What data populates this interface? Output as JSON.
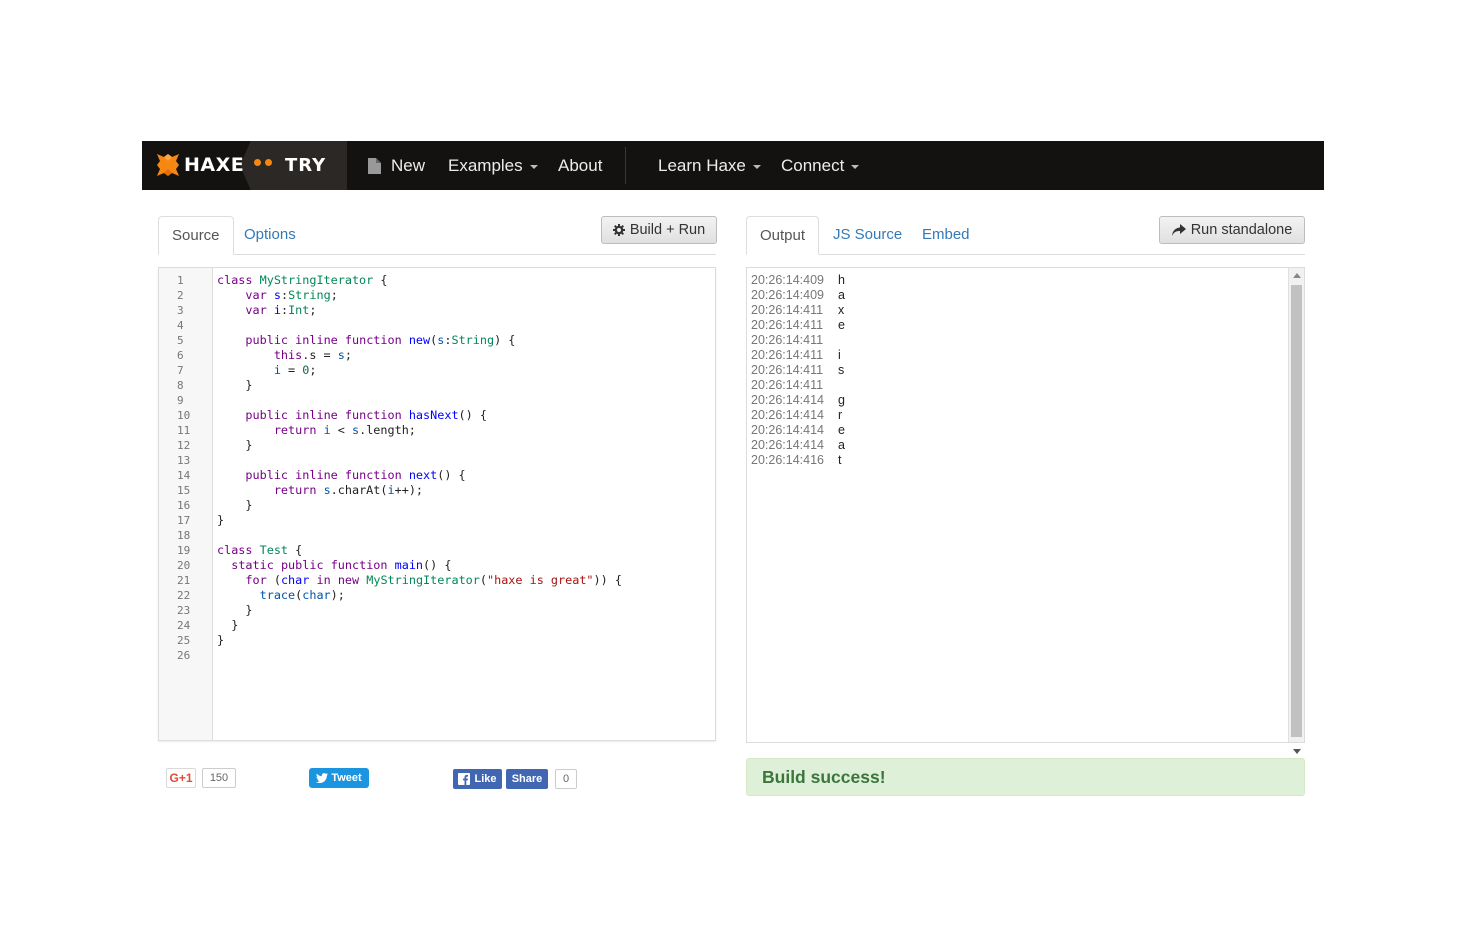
{
  "navbar": {
    "brand_name": "HAXE",
    "brand_sub": "TRY",
    "items": [
      {
        "label": "New"
      },
      {
        "label": "Examples"
      },
      {
        "label": "About"
      },
      {
        "label": "Learn Haxe"
      },
      {
        "label": "Connect"
      }
    ]
  },
  "left_tabs": [
    {
      "label": "Source"
    },
    {
      "label": "Options"
    }
  ],
  "build_button": "Build + Run",
  "right_tabs": [
    {
      "label": "Output"
    },
    {
      "label": "JS Source"
    },
    {
      "label": "Embed"
    }
  ],
  "run_standalone_button": "Run standalone",
  "line_numbers": [
    "1",
    "2",
    "3",
    "4",
    "5",
    "6",
    "7",
    "8",
    "9",
    "10",
    "11",
    "12",
    "13",
    "14",
    "15",
    "16",
    "17",
    "18",
    "19",
    "20",
    "21",
    "22",
    "23",
    "24",
    "25",
    "26"
  ],
  "output_rows": [
    {
      "time": "20:26:14:409",
      "value": "h"
    },
    {
      "time": "20:26:14:409",
      "value": "a"
    },
    {
      "time": "20:26:14:411",
      "value": "x"
    },
    {
      "time": "20:26:14:411",
      "value": "e"
    },
    {
      "time": "20:26:14:411",
      "value": ""
    },
    {
      "time": "20:26:14:411",
      "value": "i"
    },
    {
      "time": "20:26:14:411",
      "value": "s"
    },
    {
      "time": "20:26:14:411",
      "value": ""
    },
    {
      "time": "20:26:14:414",
      "value": "g"
    },
    {
      "time": "20:26:14:414",
      "value": "r"
    },
    {
      "time": "20:26:14:414",
      "value": "e"
    },
    {
      "time": "20:26:14:414",
      "value": "a"
    },
    {
      "time": "20:26:14:416",
      "value": "t"
    }
  ],
  "status": "Build success!",
  "social": {
    "gplus_label": "G+1",
    "gplus_count": "150",
    "tweet_label": "Tweet",
    "fb_like": "Like",
    "fb_share": "Share",
    "fb_count": "0"
  },
  "colors": {
    "navbar_bg": "#141210",
    "brand_accent": "#f68712",
    "link": "#337ab7",
    "success_bg": "#dff0d8",
    "success_text": "#3c763d"
  },
  "code_tokens": {
    "l1": [
      "class",
      "MyStringIterator",
      "{"
    ],
    "l2": [
      "var",
      "s",
      ":",
      "String",
      ";"
    ],
    "l3": [
      "var",
      "i",
      ":",
      "Int",
      ";"
    ],
    "l5": [
      "public",
      "inline",
      "function",
      "new",
      "(",
      "s",
      ":",
      "String",
      ") {"
    ],
    "l6": [
      "this",
      ".s = ",
      "s",
      ";"
    ],
    "l7": [
      "i",
      " = ",
      "0",
      ";"
    ],
    "l8": [
      "}"
    ],
    "l10": [
      "public",
      "inline",
      "function",
      "hasNext",
      "() {"
    ],
    "l11": [
      "return",
      "i",
      " < ",
      "s",
      ".length;"
    ],
    "l12": [
      "}"
    ],
    "l14": [
      "public",
      "inline",
      "function",
      "next",
      "() {"
    ],
    "l15": [
      "return",
      "s",
      ".charAt(",
      "i",
      "++);"
    ],
    "l16": [
      "}"
    ],
    "l17": [
      "}"
    ],
    "l19": [
      "class",
      "Test",
      "{"
    ],
    "l20": [
      "static",
      "public",
      "function",
      "main",
      "() {"
    ],
    "l21": [
      "for",
      " (",
      "char",
      "in",
      "new",
      "MyStringIterator",
      "(",
      "\"haxe is great\"",
      ")) {"
    ],
    "l22": [
      "trace",
      "(",
      "char",
      ");"
    ],
    "l23": [
      "}"
    ],
    "l24": [
      "}"
    ],
    "l25": [
      "}"
    ]
  }
}
